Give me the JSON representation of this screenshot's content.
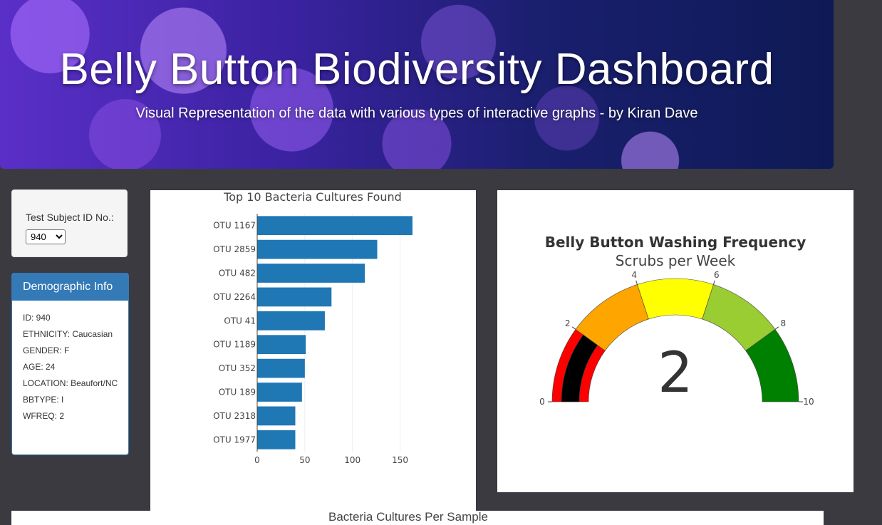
{
  "header": {
    "title": "Belly Button Biodiversity Dashboard",
    "subtitle": "Visual Representation of the data with various types of interactive graphs - by Kiran Dave"
  },
  "selector": {
    "label": "Test Subject ID No.:",
    "selected": "940"
  },
  "demographics": {
    "title": "Demographic Info",
    "rows": [
      "ID: 940",
      "ETHNICITY: Caucasian",
      "GENDER: F",
      "AGE: 24",
      "LOCATION: Beaufort/NC",
      "BBTYPE: I",
      "WFREQ: 2"
    ]
  },
  "chart_data": [
    {
      "type": "bar",
      "orientation": "horizontal",
      "title": "Top 10 Bacteria Cultures Found",
      "categories": [
        "OTU 1167",
        "OTU 2859",
        "OTU 482",
        "OTU 2264",
        "OTU 41",
        "OTU 1189",
        "OTU 352",
        "OTU 189",
        "OTU 2318",
        "OTU 1977"
      ],
      "values": [
        163,
        126,
        113,
        78,
        71,
        51,
        50,
        47,
        40,
        40
      ],
      "xlim": [
        0,
        175
      ],
      "xticks": [
        0,
        50,
        100,
        150
      ],
      "color": "#1f77b4",
      "grid": true
    },
    {
      "type": "gauge",
      "title": "Belly Button Washing Frequency",
      "subtitle": "Scrubs per Week",
      "value": 2,
      "range": [
        0,
        10
      ],
      "ticks": [
        0,
        2,
        4,
        6,
        8,
        10
      ],
      "steps": [
        {
          "range": [
            0,
            2
          ],
          "color": "#ff0000"
        },
        {
          "range": [
            2,
            4
          ],
          "color": "#ffa500"
        },
        {
          "range": [
            4,
            6
          ],
          "color": "#ffff00"
        },
        {
          "range": [
            6,
            8
          ],
          "color": "#9acd32"
        },
        {
          "range": [
            8,
            10
          ],
          "color": "#008000"
        }
      ],
      "bar_color": "#000000"
    }
  ],
  "bottom_chart": {
    "title": "Bacteria Cultures Per Sample"
  }
}
